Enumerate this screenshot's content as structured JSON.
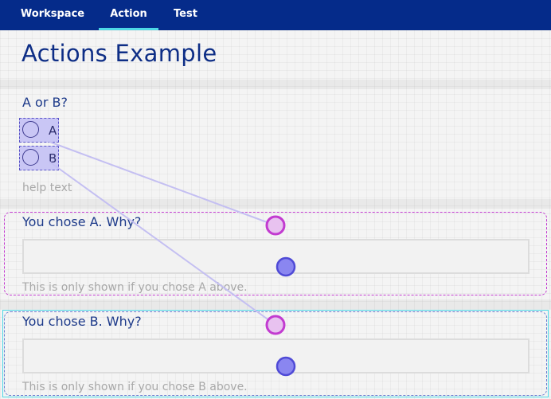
{
  "nav": {
    "tabs": [
      {
        "label": "Workspace"
      },
      {
        "label": "Action"
      },
      {
        "label": "Test"
      }
    ],
    "active_index": 1,
    "accent": "#4dd8e6",
    "background": "#052b8a"
  },
  "page": {
    "title": "Actions Example"
  },
  "question": {
    "label": "A or B?",
    "options": [
      {
        "label": "A"
      },
      {
        "label": "B"
      }
    ],
    "help": "help text"
  },
  "sections": [
    {
      "label": "You chose A. Why?",
      "note": "This is only shown if you chose A above."
    },
    {
      "label": "You chose B. Why?",
      "note": "This is only shown if you chose B above."
    }
  ],
  "colors": {
    "title": "#0e2e86",
    "radio_fill": "#c9c6f5",
    "connector_line": "#c4bff2",
    "node_magenta": "#c23bd0",
    "node_blue": "#8a86f0"
  }
}
